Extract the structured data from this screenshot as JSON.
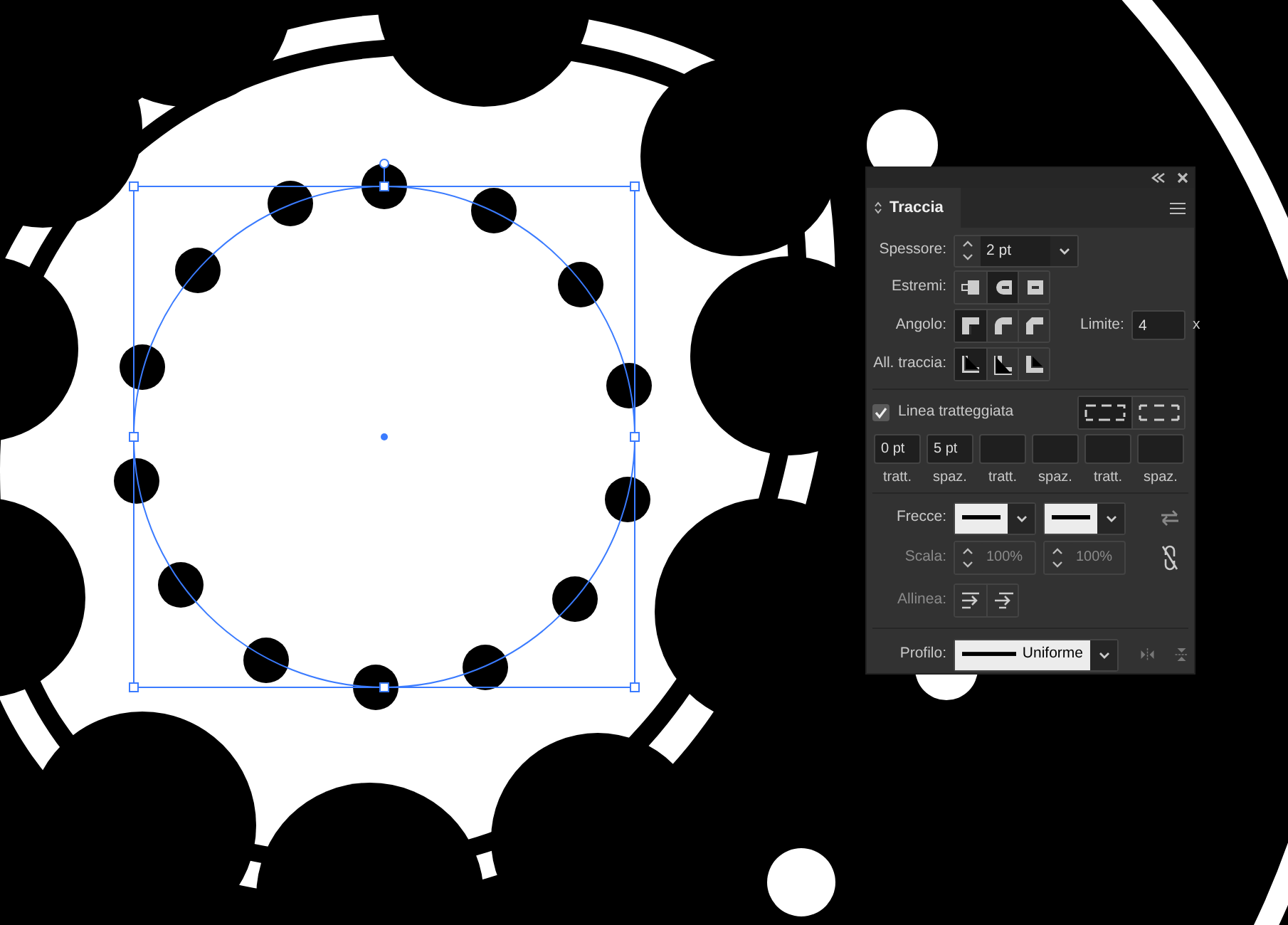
{
  "panel": {
    "tab": {
      "label": "Traccia",
      "selected": true
    },
    "weight": {
      "label": "Spessore:",
      "value": "2 pt"
    },
    "caps": {
      "label": "Estremi:",
      "options": [
        {
          "kind": "butt",
          "selected": false
        },
        {
          "kind": "round",
          "selected": true
        },
        {
          "kind": "square",
          "selected": false
        }
      ]
    },
    "corner": {
      "label": "Angolo:",
      "options": [
        {
          "kind": "miter",
          "selected": true
        },
        {
          "kind": "round",
          "selected": false
        },
        {
          "kind": "bevel",
          "selected": false
        }
      ],
      "limit": {
        "label": "Limite:",
        "value": "4",
        "suffix": "x"
      }
    },
    "align": {
      "label": "All. traccia:",
      "options": [
        {
          "kind": "center",
          "selected": true
        },
        {
          "kind": "inside",
          "selected": false
        },
        {
          "kind": "outside",
          "selected": false
        }
      ]
    },
    "dashed": {
      "label": "Linea tratteggiata",
      "checked": true,
      "modes": [
        {
          "kind": "exact",
          "selected": true
        },
        {
          "kind": "adjust",
          "selected": false
        }
      ],
      "fields": [
        {
          "value": "0 pt",
          "label": "tratt."
        },
        {
          "value": "5 pt",
          "label": "spaz."
        },
        {
          "label": "tratt."
        },
        {
          "label": "spaz."
        },
        {
          "label": "tratt."
        },
        {
          "label": "spaz."
        }
      ]
    },
    "arrows": {
      "label": "Frecce:"
    },
    "scale": {
      "label": "Scala:",
      "disabled": true,
      "values": [
        "100%",
        "100%"
      ]
    },
    "arrow_align": {
      "label": "Allinea:",
      "disabled": true
    },
    "profile": {
      "label": "Profilo:",
      "value": "Uniforme"
    }
  }
}
